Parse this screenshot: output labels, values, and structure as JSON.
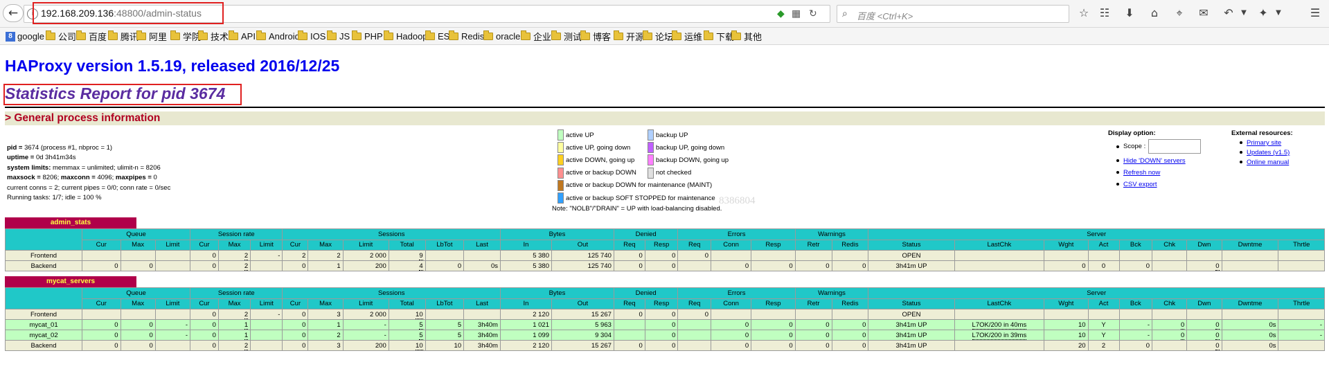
{
  "browser": {
    "url_host": "192.168.209.136",
    "url_path": ":48800/admin-status",
    "search_placeholder": "百度 <Ctrl+K>"
  },
  "bookmarks": [
    "google",
    "公司",
    "百度",
    "腾讯",
    "阿里",
    "学院",
    "技术",
    "API",
    "Android",
    "IOS",
    "JS",
    "PHP",
    "Hadoop",
    "ES",
    "Redis",
    "oracle",
    "企业",
    "测试",
    "博客",
    "开源",
    "论坛",
    "运维",
    "下载",
    "其他"
  ],
  "page": {
    "title": "HAProxy version 1.5.19, released 2016/12/25",
    "stats_title": "Statistics Report for pid 3674",
    "section_title": "> General process information"
  },
  "process_info": [
    {
      "key": "pid = ",
      "val": "3674 (process #1, nbproc = 1)"
    },
    {
      "key": "uptime = ",
      "val": "0d 3h41m34s"
    },
    {
      "key": "system limits:",
      "val": " memmax = unlimited; ulimit-n = 8206"
    },
    {
      "key": "maxsock = ",
      "val": "8206; ",
      "key2": "maxconn = ",
      "val2": "4096; ",
      "key3": "maxpipes = ",
      "val3": "0"
    },
    {
      "key": "",
      "val": "current conns = 2; current pipes = 0/0; conn rate = 0/sec"
    },
    {
      "key": "",
      "val": "Running tasks: 1/7; idle = 100 %"
    }
  ],
  "legend_left": [
    {
      "label": "active UP",
      "color": "#c0ffc0"
    },
    {
      "label": "active UP, going down",
      "color": "#ffffa0"
    },
    {
      "label": "active DOWN, going up",
      "color": "#ffd020"
    },
    {
      "label": "active or backup DOWN",
      "color": "#ff9090"
    },
    {
      "label": "active or backup DOWN for maintenance (MAINT)",
      "color": "#c07820"
    },
    {
      "label": "active or backup SOFT STOPPED for maintenance",
      "color": "#30a0ff"
    }
  ],
  "legend_right": [
    {
      "label": "backup UP",
      "color": "#b0d0ff"
    },
    {
      "label": "backup UP, going down",
      "color": "#c060ff"
    },
    {
      "label": "backup DOWN, going up",
      "color": "#ff80ff"
    },
    {
      "label": "not checked",
      "color": "#e0e0e0"
    }
  ],
  "legend_note": "Note: \"NOLB\"/\"DRAIN\" = UP with load-balancing disabled.",
  "watermark": "8386804",
  "display_options": {
    "title": "Display option:",
    "scope_label": "Scope :",
    "hide_down": "Hide 'DOWN' servers",
    "refresh": "Refresh now",
    "csv": "CSV export"
  },
  "external_resources": {
    "title": "External resources:",
    "links": [
      "Primary site",
      "Updates (v1.5)",
      "Online manual"
    ]
  },
  "table_headers": {
    "groups": [
      "Queue",
      "Session rate",
      "Sessions",
      "Bytes",
      "Denied",
      "Errors",
      "Warnings",
      "Server"
    ],
    "columns": [
      "Cur",
      "Max",
      "Limit",
      "Cur",
      "Max",
      "Limit",
      "Cur",
      "Max",
      "Limit",
      "Total",
      "LbTot",
      "Last",
      "In",
      "Out",
      "Req",
      "Resp",
      "Req",
      "Conn",
      "Resp",
      "Retr",
      "Redis",
      "Status",
      "LastChk",
      "Wght",
      "Act",
      "Bck",
      "Chk",
      "Dwn",
      "Dwntme",
      "Thrtle"
    ]
  },
  "proxies": [
    {
      "name": "admin_stats",
      "rows": [
        {
          "type": "fe",
          "cells": [
            "Frontend",
            "",
            "",
            "",
            "0",
            "2",
            "-",
            "2",
            "2",
            "2 000",
            "9",
            "",
            "",
            "5 380",
            "125 740",
            "0",
            "0",
            "0",
            "",
            "",
            "",
            "",
            "OPEN",
            "",
            "",
            "",
            "",
            "",
            "",
            "",
            ""
          ]
        },
        {
          "type": "be",
          "cells": [
            "Backend",
            "0",
            "0",
            "",
            "0",
            "2",
            "",
            "0",
            "1",
            "200",
            "4",
            "0",
            "0s",
            "5 380",
            "125 740",
            "0",
            "0",
            "",
            "0",
            "0",
            "0",
            "0",
            "3h41m UP",
            "",
            "0",
            "0",
            "0",
            "",
            "0",
            "",
            ""
          ]
        }
      ]
    },
    {
      "name": "mycat_servers",
      "rows": [
        {
          "type": "fe",
          "cells": [
            "Frontend",
            "",
            "",
            "",
            "0",
            "2",
            "-",
            "0",
            "3",
            "2 000",
            "10",
            "",
            "",
            "2 120",
            "15 267",
            "0",
            "0",
            "0",
            "",
            "",
            "",
            "",
            "OPEN",
            "",
            "",
            "",
            "",
            "",
            "",
            "",
            ""
          ]
        },
        {
          "type": "up",
          "cells": [
            "mycat_01",
            "0",
            "0",
            "-",
            "0",
            "1",
            "",
            "0",
            "1",
            "-",
            "5",
            "5",
            "3h40m",
            "1 021",
            "5 963",
            "",
            "0",
            "",
            "0",
            "0",
            "0",
            "0",
            "3h41m UP",
            "L7OK/200 in 40ms",
            "10",
            "Y",
            "-",
            "0",
            "0",
            "0s",
            "-"
          ]
        },
        {
          "type": "up",
          "cells": [
            "mycat_02",
            "0",
            "0",
            "-",
            "0",
            "1",
            "",
            "0",
            "2",
            "-",
            "5",
            "5",
            "3h40m",
            "1 099",
            "9 304",
            "",
            "0",
            "",
            "0",
            "0",
            "0",
            "0",
            "3h41m UP",
            "L7OK/200 in 39ms",
            "10",
            "Y",
            "-",
            "0",
            "0",
            "0s",
            "-"
          ]
        },
        {
          "type": "be",
          "cells": [
            "Backend",
            "0",
            "0",
            "",
            "0",
            "2",
            "",
            "0",
            "3",
            "200",
            "10",
            "10",
            "3h40m",
            "2 120",
            "15 267",
            "0",
            "0",
            "",
            "0",
            "0",
            "0",
            "0",
            "3h41m UP",
            "",
            "20",
            "2",
            "0",
            "",
            "0",
            "0s",
            ""
          ]
        }
      ]
    }
  ]
}
